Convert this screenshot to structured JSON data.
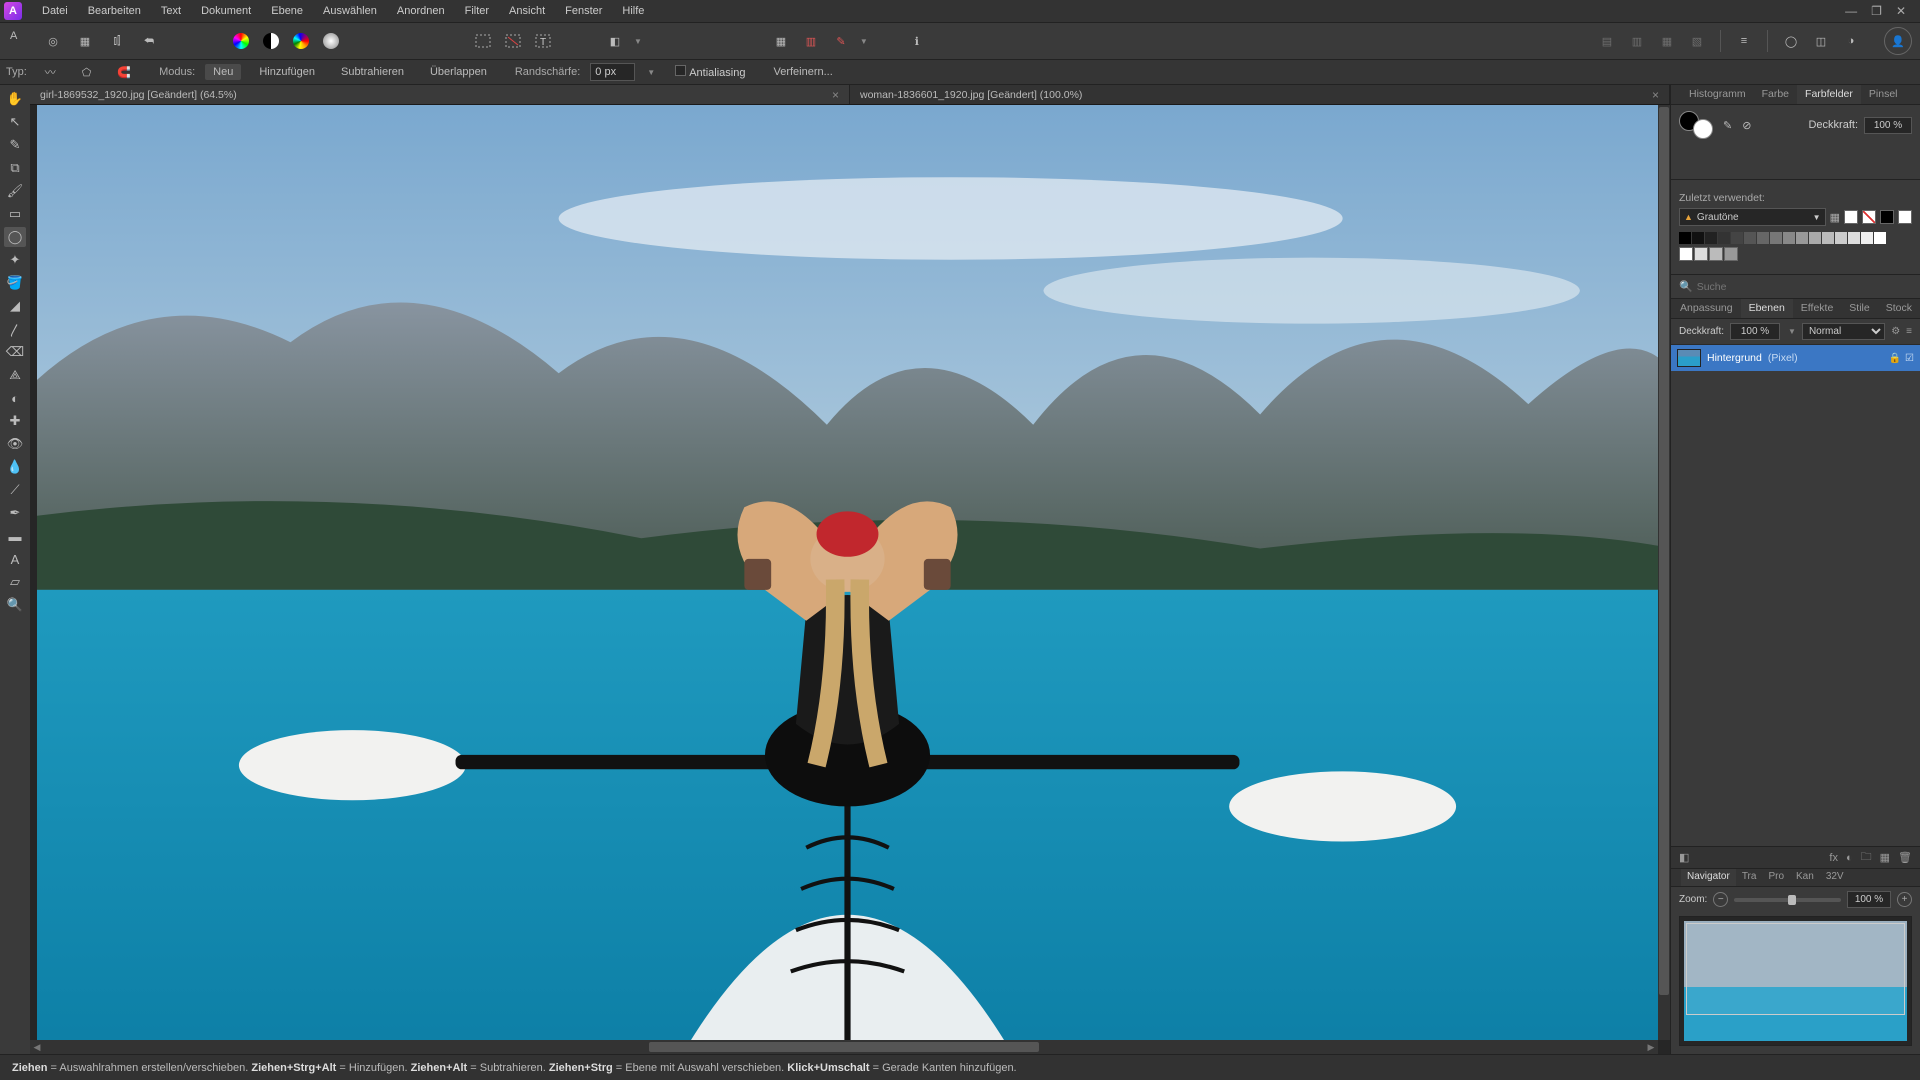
{
  "menu": {
    "items": [
      "Datei",
      "Bearbeiten",
      "Text",
      "Dokument",
      "Ebene",
      "Auswählen",
      "Anordnen",
      "Filter",
      "Ansicht",
      "Fenster",
      "Hilfe"
    ]
  },
  "win_controls": {
    "min": "—",
    "max": "❐",
    "close": "✕"
  },
  "context": {
    "type_label": "Typ:",
    "mode_label": "Modus:",
    "mode_new": "Neu",
    "mode_add": "Hinzufügen",
    "mode_sub": "Subtrahieren",
    "mode_overlap": "Überlappen",
    "feather_label": "Randschärfe:",
    "feather_value": "0 px",
    "antialias": "Antialiasing",
    "refine": "Verfeinern..."
  },
  "tabs": {
    "t1": "girl-1869532_1920.jpg [Geändert] (64.5%)",
    "t2": "woman-1836601_1920.jpg [Geändert] (100.0%)"
  },
  "color_panel": {
    "tabs": [
      "Histogramm",
      "Farbe",
      "Farbfelder",
      "Pinsel"
    ],
    "active_tab": "Farbfelder",
    "opacity_label": "Deckkraft:",
    "opacity_value": "100 %",
    "recent_label": "Zuletzt verwendet:",
    "palette_name": "Grautöne"
  },
  "search": {
    "placeholder": "Suche"
  },
  "layers_panel": {
    "tabs": [
      "Anpassung",
      "Ebenen",
      "Effekte",
      "Stile",
      "Stock"
    ],
    "active_tab": "Ebenen",
    "opacity_label": "Deckkraft:",
    "opacity_value": "100 %",
    "blend_mode": "Normal",
    "layer_name": "Hintergrund",
    "layer_type": "(Pixel)"
  },
  "navigator": {
    "tabs": [
      "Navigator",
      "Tra",
      "Pro",
      "Kan",
      "32V"
    ],
    "active_tab": "Navigator",
    "zoom_label": "Zoom:",
    "zoom_value": "100 %"
  },
  "status": {
    "s1a": "Ziehen",
    "s1b": " = Auswahlrahmen erstellen/verschieben. ",
    "s2a": "Ziehen+Strg+Alt",
    "s2b": " = Hinzufügen. ",
    "s3a": "Ziehen+Alt",
    "s3b": " = Subtrahieren. ",
    "s4a": "Ziehen+Strg",
    "s4b": " = Ebene mit Auswahl verschieben. ",
    "s5a": "Klick+Umschalt",
    "s5b": " = Gerade Kanten hinzufügen."
  }
}
